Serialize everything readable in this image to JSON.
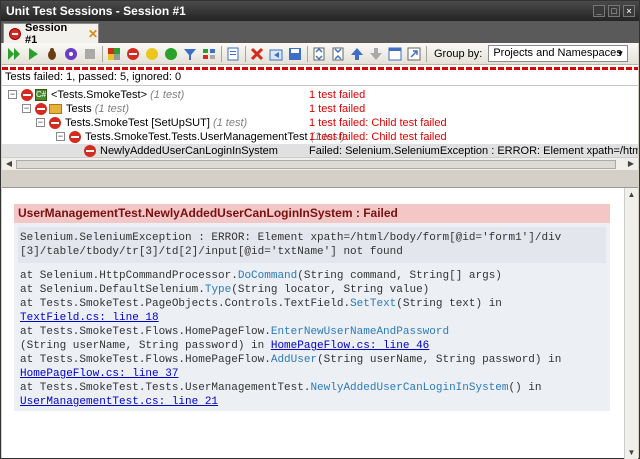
{
  "window": {
    "title": "Unit Test Sessions - Session #1"
  },
  "tab": {
    "label": "Session #1"
  },
  "toolbar": {
    "group_by_label": "Group by:",
    "group_by_value": "Projects and Namespaces"
  },
  "status": {
    "summary": "Tests failed: 1, passed: 5, ignored: 0"
  },
  "tree": {
    "rows": [
      {
        "name": "<Tests.SmokeTest>",
        "count": "(1 test)",
        "result": "1 test failed"
      },
      {
        "name": "Tests",
        "count": "(1 test)",
        "result": "1 test failed"
      },
      {
        "name": "Tests.SmokeTest [SetUpSUT]",
        "count": "(1 test)",
        "result": "1 test failed: Child test failed"
      },
      {
        "name": "Tests.SmokeTest.Tests.UserManagementTest",
        "count": "(1 test)",
        "result": "1 test failed: Child test failed"
      },
      {
        "name": "NewlyAddedUserCanLoginInSystem",
        "count": "",
        "result": "Failed: Selenium.SeleniumException : ERROR: Element xpath=/html/body/form[@"
      }
    ]
  },
  "details": {
    "title": "UserManagementTest.NewlyAddedUserCanLoginInSystem : Failed",
    "exception": [
      "Selenium.SeleniumException : ERROR: Element xpath=/html/body/form[@id='form1']/div",
      "[3]/table/tbody/tr[3]/td[2]/input[@id='txtName'] not found"
    ],
    "trace": [
      {
        "a": "at Selenium.HttpCommandProcessor.",
        "m": "DoCommand",
        "b": "(String command, String[] args)"
      },
      {
        "a": "at Selenium.DefaultSelenium.",
        "m": "Type",
        "b": "(String locator, String value)"
      },
      {
        "a": "at Tests.SmokeTest.PageObjects.Controls.TextField.",
        "m": "SetText",
        "b": "(String text) in"
      },
      {
        "link": "TextField.cs: line 18"
      },
      {
        "a": "at Tests.SmokeTest.Flows.HomePageFlow.",
        "m": "EnterNewUserNameAndPassword",
        "b": ""
      },
      {
        "a": "(String userName, String password) in ",
        "link": "HomePageFlow.cs: line 46"
      },
      {
        "a": "at Tests.SmokeTest.Flows.HomePageFlow.",
        "m": "AddUser",
        "b": "(String userName, String password) in"
      },
      {
        "link": "HomePageFlow.cs: line 37"
      },
      {
        "a": "at Tests.SmokeTest.Tests.UserManagementTest.",
        "m": "NewlyAddedUserCanLoginInSystem",
        "b": "() in"
      },
      {
        "link": "UserManagementTest.cs: line 21"
      }
    ]
  },
  "colors": {
    "fail": "#e00000",
    "card_title_bg": "#f4c7c7",
    "method": "#2b7bb9",
    "link": "#0000cc"
  }
}
